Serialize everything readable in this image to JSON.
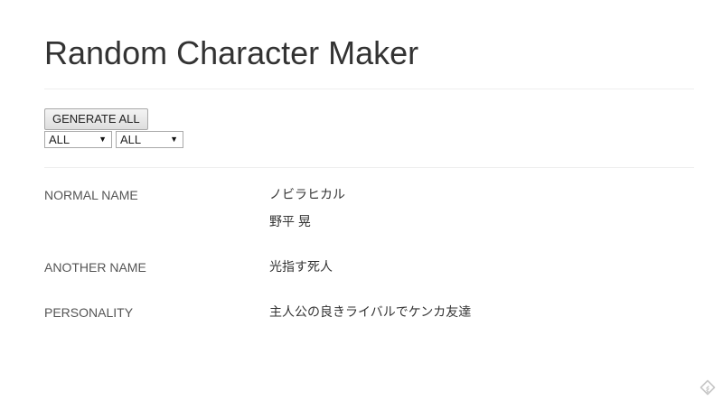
{
  "header": {
    "title": "Random Character Maker"
  },
  "controls": {
    "generate_label": "GENERATE ALL",
    "select_1_value": "ALL",
    "select_2_value": "ALL"
  },
  "results": {
    "normal_name_label": "NORMAL NAME",
    "normal_name_kana": "ノビラヒカル",
    "normal_name_kanji": "野平 晃",
    "another_name_label": "ANOTHER NAME",
    "another_name_value": "光指す死人",
    "personality_label": "PERSONALITY",
    "personality_value": "主人公の良きライバルでケンカ友達"
  },
  "icons": {
    "corner": "feedly-icon"
  },
  "colors": {
    "text": "#333333",
    "label": "#555555",
    "divider": "#eeeeee",
    "corner_icon": "#c8c8c8"
  }
}
